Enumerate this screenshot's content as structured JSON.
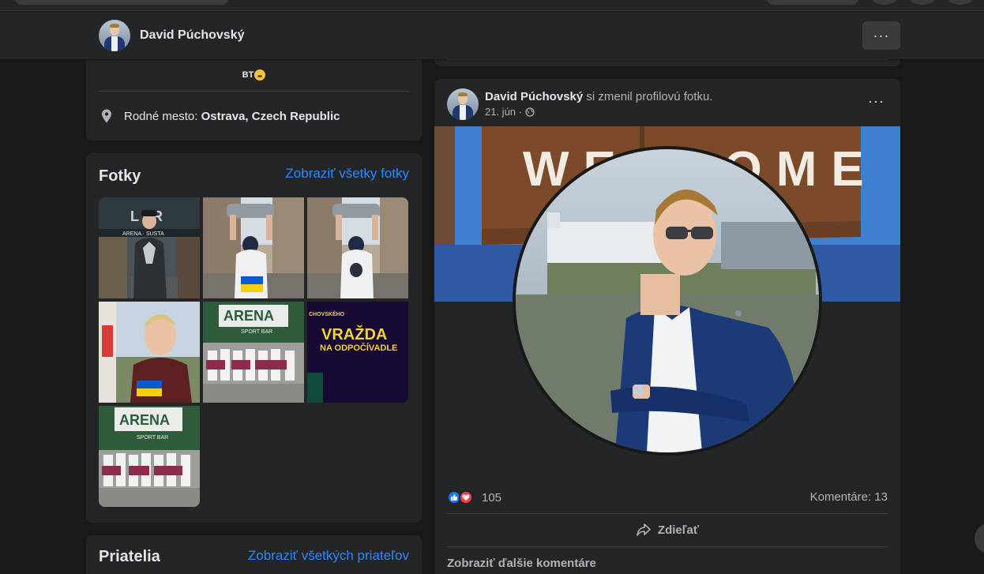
{
  "header": {
    "name": "David Púchovský",
    "more_label": "···"
  },
  "intro": {
    "bio_text": "BT",
    "hometown_prefix": "Rodné mesto:",
    "hometown_value": "Ostrava, Czech Republic"
  },
  "photos": {
    "title": "Fotky",
    "see_all": "Zobraziť všetky fotky",
    "tiles": [
      {
        "sign_text": "ARENA · SUSTA"
      },
      {
        "flag": "Ukraine"
      },
      {
        "flag": "none"
      },
      {
        "flag": "Ukraine"
      },
      {
        "sign_text": "ARENA",
        "sub_text": "SPORT BAR"
      },
      {
        "line1": "CHOVSKÉHO",
        "line2": "VRAŽDA",
        "line3": "NA ODPOČÍVADLE"
      },
      {
        "sign_text": "ARENA",
        "sub_text": "SPORT BAR"
      }
    ]
  },
  "friends": {
    "title": "Priatelia",
    "see_all": "Zobraziť všetkých priateľov"
  },
  "post": {
    "author": "David Púchovský",
    "action": " si zmenil profilovú fotku.",
    "date": "21. jún ·",
    "cover_sign": "WELCOME TO",
    "reaction_count": "105",
    "comments_label": "Komentáre: 13",
    "share_label": "Zdieľať",
    "more_comments": "Zobraziť ďalšie komentáre",
    "more_label": "···"
  },
  "colors": {
    "background": "#18191a",
    "card": "#242526",
    "link": "#2d88ff",
    "like": "#1877f2",
    "love": "#f33e58"
  }
}
